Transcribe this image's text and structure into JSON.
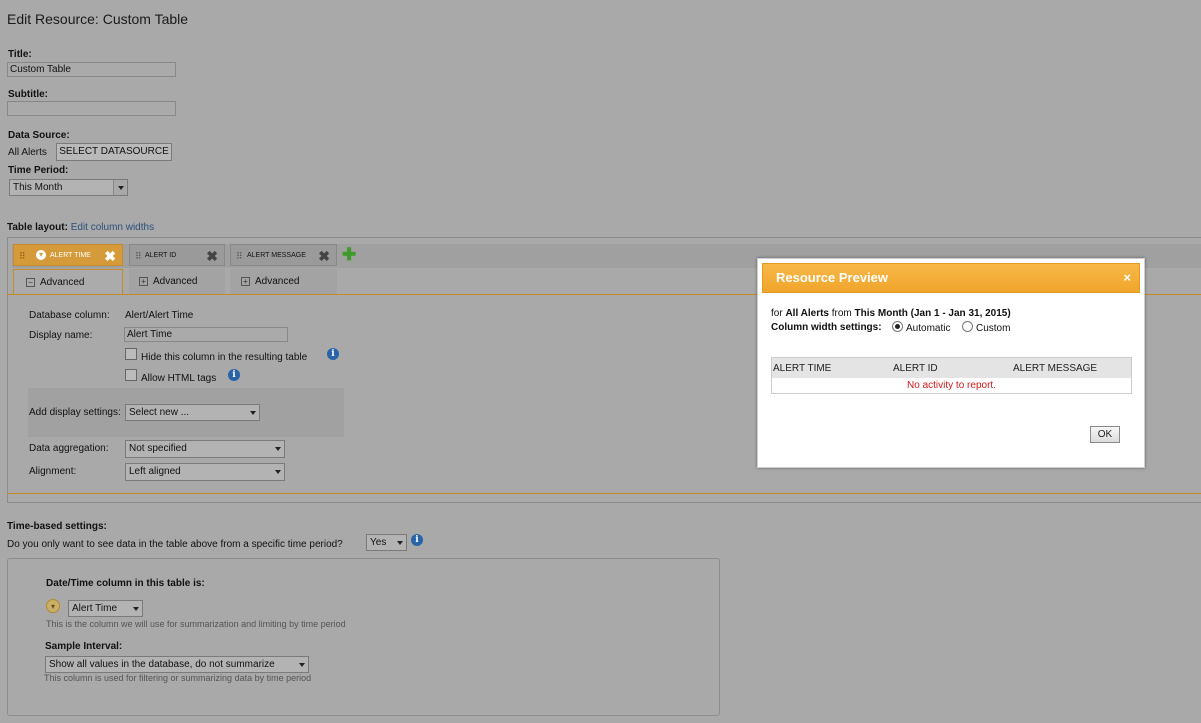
{
  "page": {
    "title": "Edit Resource: Custom Table"
  },
  "form": {
    "title_label": "Title:",
    "title_value": "Custom Table",
    "subtitle_label": "Subtitle:",
    "subtitle_value": "",
    "datasource_label": "Data Source:",
    "datasource_value": "All Alerts",
    "select_datasource_button": "SELECT DATASOURCE",
    "time_period_label": "Time Period:",
    "time_period_value": "This Month"
  },
  "table_layout": {
    "label": "Table layout:",
    "edit_widths_link": "Edit column widths",
    "columns": [
      {
        "label": "ALERT TIME",
        "advanced": "Advanced"
      },
      {
        "label": "ALERT ID",
        "advanced": "Advanced"
      },
      {
        "label": "ALERT MESSAGE",
        "advanced": "Advanced"
      }
    ],
    "add_column_icon": "plus-icon"
  },
  "column_settings": {
    "db_column_label": "Database column:",
    "db_column_value": "Alert/Alert Time",
    "display_name_label": "Display name:",
    "display_name_value": "Alert Time",
    "hide_label": "Hide this column in the resulting table",
    "html_label": "Allow HTML tags",
    "add_display_label": "Add display settings:",
    "add_display_value": "Select new ...",
    "aggregation_label": "Data aggregation:",
    "aggregation_value": "Not specified",
    "alignment_label": "Alignment:",
    "alignment_value": "Left aligned"
  },
  "time_settings": {
    "heading": "Time-based settings:",
    "question": "Do you only want to see data in the table above from a specific time period?",
    "question_value": "Yes",
    "datetime_label": "Date/Time column in this table is:",
    "datetime_value": "Alert Time",
    "datetime_hint": "This is the column we will use for summarization and limiting by time period",
    "interval_label": "Sample Interval:",
    "interval_value": "Show all values in the database, do not summarize",
    "interval_hint": "This column is used for filtering or summarizing data by time period"
  },
  "modal": {
    "title": "Resource Preview",
    "close": "×",
    "for_prefix": "for",
    "source": "All Alerts",
    "from_word": "from",
    "period": "This Month (Jan 1 - Jan 31, 2015)",
    "width_label": "Column width settings:",
    "option_automatic": "Automatic",
    "option_custom": "Custom",
    "selected_option": "Automatic",
    "headers": [
      "ALERT TIME",
      "ALERT ID",
      "ALERT MESSAGE"
    ],
    "empty_message": "No activity to report.",
    "ok_button": "OK"
  },
  "colors": {
    "accent_orange": "#f0a52c",
    "active_tab": "#d59a39",
    "error_red": "#d01818",
    "info_blue": "#2a64a8",
    "link_blue": "#2d4f7a"
  }
}
